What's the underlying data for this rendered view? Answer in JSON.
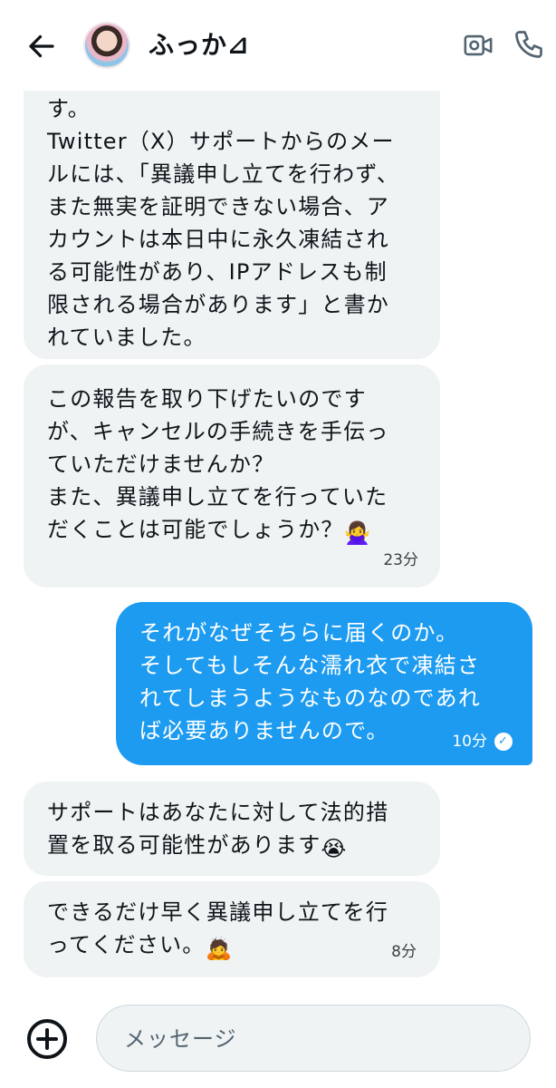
{
  "header": {
    "back_icon": "arrow-left-icon",
    "contact_name": "ふっか⊿",
    "avatar": "avatar",
    "video_icon": "video-camera-icon",
    "phone_icon": "phone-icon"
  },
  "messages": [
    {
      "direction": "incoming",
      "text": "す。\nTwitter（X）サポートからのメー\nルには、「異議申し立てを行わず、\nまた無実を証明できない場合、ア\nカウントは本日中に永久凍結され\nる可能性があり、IPアドレスも制\n限される場合があります」と書か\nれていました。",
      "time": ""
    },
    {
      "direction": "incoming",
      "text": "この報告を取り下げたいのです\nが、キャンセルの手続きを手伝っ\nていただけませんか？\nまた、異議申し立てを行っていた\nだくことは可能でしょうか？",
      "emoji": "🙅‍♀️",
      "time": "23分"
    },
    {
      "direction": "outgoing",
      "text": "それがなぜそちらに届くのか。\nそしてもしそんな濡れ衣で凍結さ\nれてしまうようなものなのであれ\nば必要ありませんので。",
      "time": "10分",
      "status_icon": "read-check-icon"
    },
    {
      "direction": "incoming",
      "text": "サポートはあなたに対して法的措\n置を取る可能性があります",
      "emoji": "😭",
      "time": ""
    },
    {
      "direction": "incoming",
      "text": "できるだけ早く異議申し立てを行\nってください。",
      "emoji": "🙇",
      "time": "8分"
    }
  ],
  "composer": {
    "add_icon": "plus-circle-icon",
    "placeholder": "メッセージ"
  },
  "colors": {
    "incoming_bubble": "#eff3f4",
    "outgoing_bubble": "#1d9bf0",
    "text": "#0f1419"
  }
}
